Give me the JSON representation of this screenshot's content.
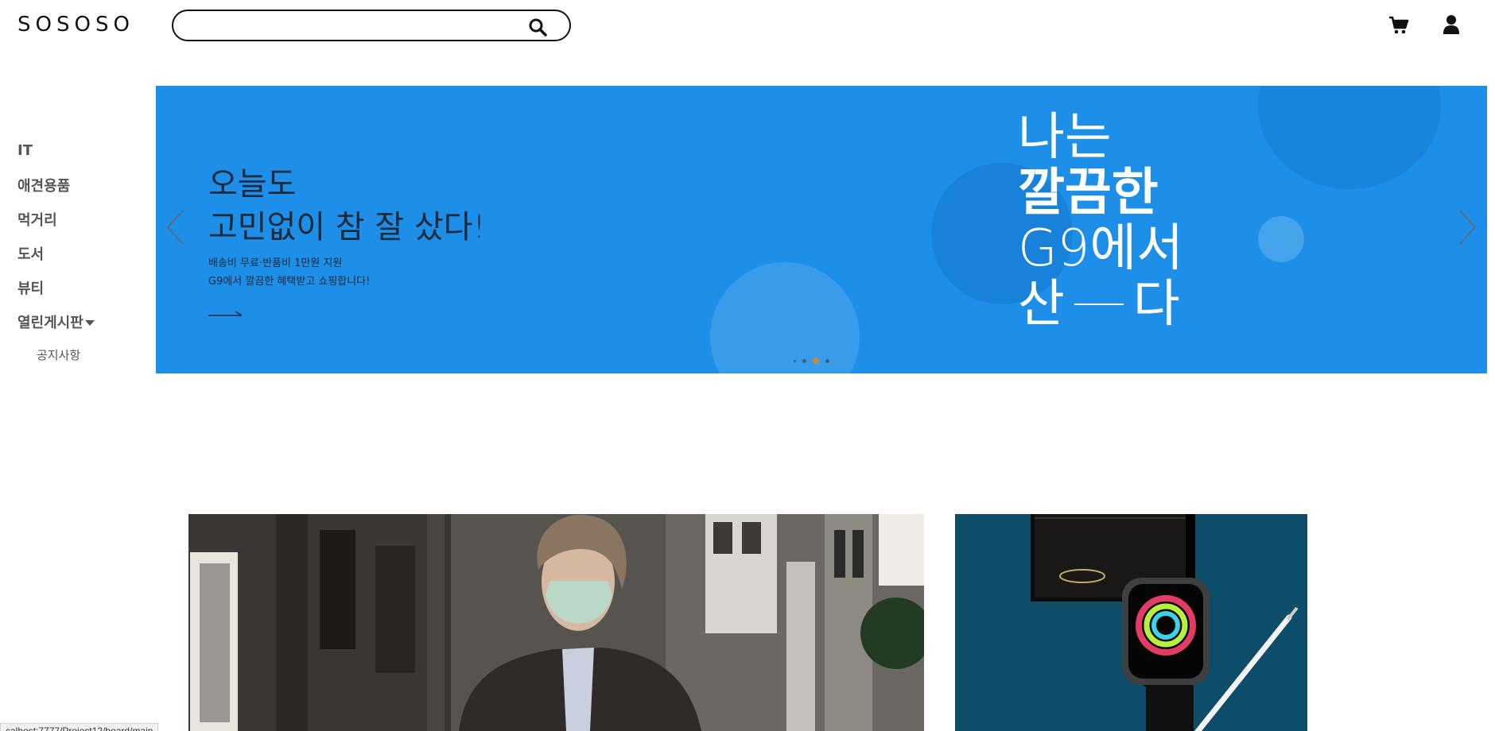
{
  "header": {
    "logo": "SOSOSO",
    "search": {
      "value": "",
      "placeholder": ""
    }
  },
  "sidebar": {
    "items": [
      {
        "label": "IT"
      },
      {
        "label": "애견용품"
      },
      {
        "label": "먹거리"
      },
      {
        "label": "도서"
      },
      {
        "label": "뷰티"
      },
      {
        "label": "열린게시판"
      }
    ],
    "subitems": [
      {
        "label": "공지사항"
      }
    ]
  },
  "banner": {
    "headline_line1": "오늘도",
    "headline_line2": "고민없이 참 잘 샀다!",
    "sub_line1": "배송비 무료·반품비 1만원 지원",
    "sub_line2": "G9에서 깔끔한 혜택받고 쇼핑합니다!",
    "big_line1": "나는",
    "big_line2": "깔끔한",
    "big_line3": "G9에서",
    "big_line4_left": "산",
    "big_line4_right": "다",
    "background_color": "#1d8fe8",
    "slide_count": 4,
    "active_slide": 3
  },
  "status_bar": {
    "text": "calhost:7777/Project12/board/main"
  }
}
